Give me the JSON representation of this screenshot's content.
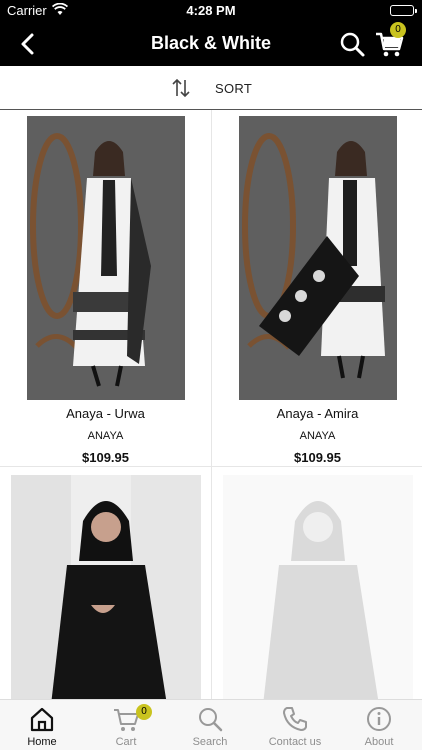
{
  "status": {
    "carrier": "Carrier",
    "time": "4:28 PM"
  },
  "header": {
    "title": "Black & White",
    "cart_count": "0"
  },
  "sortbar": {
    "label": "SORT"
  },
  "products": [
    {
      "name": "Anaya - Urwa",
      "brand": "ANAYA",
      "price": "$109.95"
    },
    {
      "name": "Anaya - Amira",
      "brand": "ANAYA",
      "price": "$109.95"
    }
  ],
  "tabs": [
    {
      "label": "Home"
    },
    {
      "label": "Cart",
      "badge": "0"
    },
    {
      "label": "Search"
    },
    {
      "label": "Contact us"
    },
    {
      "label": "About"
    }
  ],
  "colors": {
    "header_bg": "#000000",
    "badge": "#c9c31f"
  }
}
